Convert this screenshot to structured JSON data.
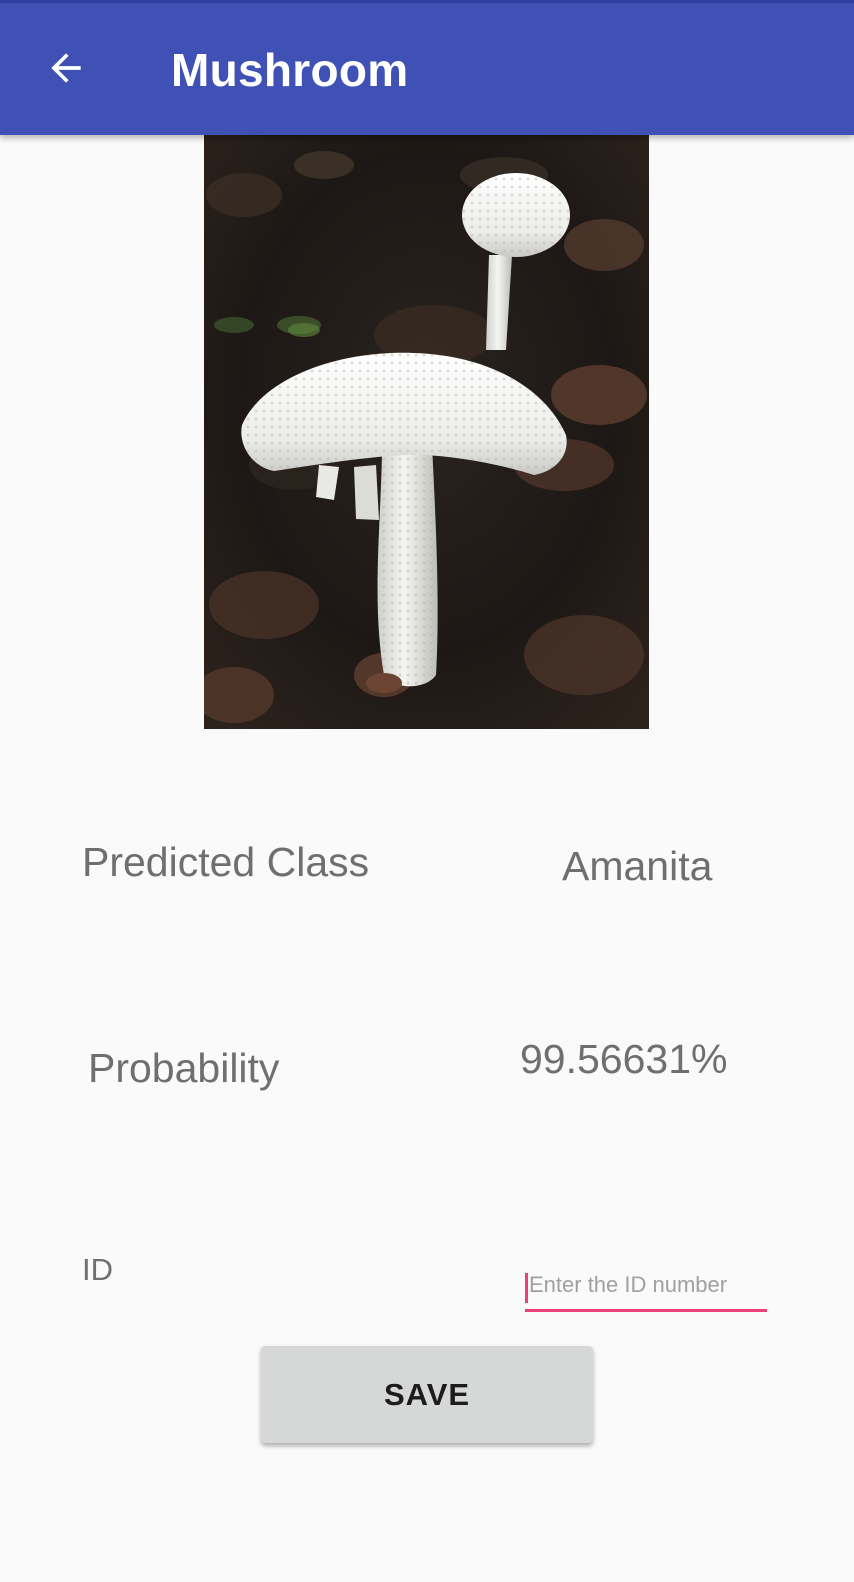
{
  "app_bar": {
    "title": "Mushroom",
    "back_icon": "arrow-left-icon",
    "color": "#3f51b5"
  },
  "image": {
    "subject": "white mushroom photo"
  },
  "results": {
    "predicted_class_label": "Predicted Class",
    "predicted_class_value": "Amanita",
    "probability_label": "Probability",
    "probability_value": "99.56631%"
  },
  "id_field": {
    "label": "ID",
    "placeholder": "Enter the ID number",
    "value": "",
    "accent_color": "#ec407a"
  },
  "actions": {
    "save_label": "SAVE"
  }
}
